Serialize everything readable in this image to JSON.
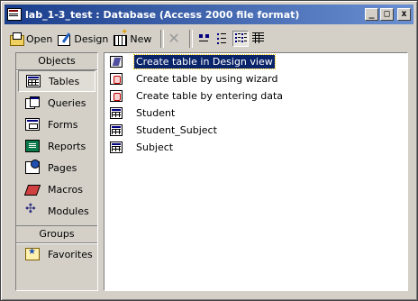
{
  "window": {
    "title": "lab_1-3_test : Database (Access 2000 file format)",
    "controls": {
      "minimize": "_",
      "maximize": "□",
      "close": "x"
    }
  },
  "toolbar": {
    "open_label": "Open",
    "design_label": "Design",
    "new_label": "New"
  },
  "sidebar": {
    "objects_header": "Objects",
    "items": [
      {
        "label": "Tables",
        "icon": "tables-icon",
        "selected": true
      },
      {
        "label": "Queries",
        "icon": "queries-icon",
        "selected": false
      },
      {
        "label": "Forms",
        "icon": "forms-icon",
        "selected": false
      },
      {
        "label": "Reports",
        "icon": "reports-icon",
        "selected": false
      },
      {
        "label": "Pages",
        "icon": "pages-icon",
        "selected": false
      },
      {
        "label": "Macros",
        "icon": "macros-icon",
        "selected": false
      },
      {
        "label": "Modules",
        "icon": "modules-icon",
        "selected": false
      }
    ],
    "groups_header": "Groups",
    "groups": [
      {
        "label": "Favorites",
        "icon": "favorites-icon"
      }
    ]
  },
  "list": {
    "items": [
      {
        "label": "Create table in Design view",
        "icon": "design-view-icon",
        "selected": true
      },
      {
        "label": "Create table by using wizard",
        "icon": "wizard-icon",
        "selected": false
      },
      {
        "label": "Create table by entering data",
        "icon": "entering-data-icon",
        "selected": false
      },
      {
        "label": "Student",
        "icon": "table-icon",
        "selected": false
      },
      {
        "label": "Student_Subject",
        "icon": "table-icon",
        "selected": false
      },
      {
        "label": "Subject",
        "icon": "table-icon",
        "selected": false
      }
    ]
  },
  "colors": {
    "titlebar_start": "#1a3d8c",
    "titlebar_end": "#6a8fd0",
    "selection": "#0a246a",
    "face": "#d4d0c8"
  }
}
